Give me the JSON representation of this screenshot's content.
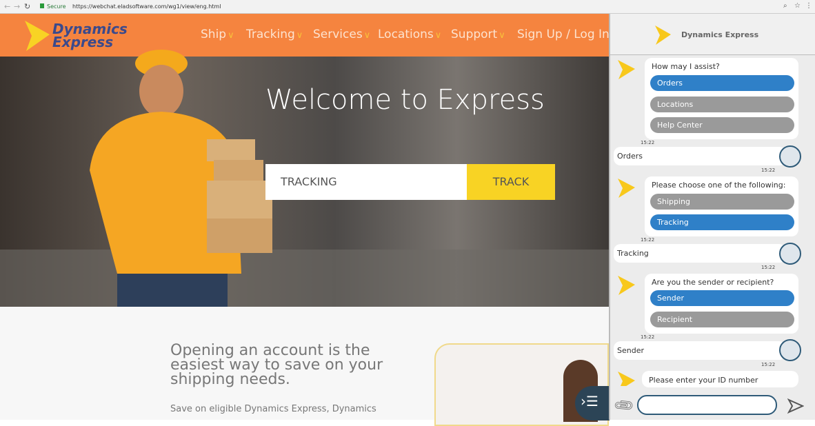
{
  "browser": {
    "secure_label": "Secure",
    "url": "https://webchat.eladsoftware.com/wg1/view/eng.html"
  },
  "site": {
    "logo": {
      "line1": "Dynamics",
      "line2": "Express"
    },
    "nav": [
      "Ship",
      "Tracking",
      "Services",
      "Locations",
      "Support"
    ],
    "signup": "Sign Up / Log In",
    "hero_title": "Welcome to Express",
    "tracking_placeholder": "TRACKING",
    "track_button": "TRACK",
    "promo_heading": "Opening an account is the easiest way to save on your shipping needs.",
    "promo_body": "Save on eligible Dynamics Express, Dynamics"
  },
  "chat": {
    "title": "Dynamics Express",
    "messages": [
      {
        "from": "bot",
        "text": "How may I assist?",
        "options": [
          {
            "label": "Orders",
            "selected": true
          },
          {
            "label": "Locations",
            "selected": false
          },
          {
            "label": "Help Center",
            "selected": false
          }
        ],
        "time": "15:22"
      },
      {
        "from": "user",
        "text": "Orders",
        "time": "15:22"
      },
      {
        "from": "bot",
        "text": "Please choose one of the following:",
        "options": [
          {
            "label": "Shipping",
            "selected": false
          },
          {
            "label": "Tracking",
            "selected": true
          }
        ],
        "time": "15:22"
      },
      {
        "from": "user",
        "text": "Tracking",
        "time": "15:22"
      },
      {
        "from": "bot",
        "text": "Are you the sender or recipient?",
        "options": [
          {
            "label": "Sender",
            "selected": true
          },
          {
            "label": "Recipient",
            "selected": false
          }
        ],
        "time": "15:22"
      },
      {
        "from": "user",
        "text": "Sender",
        "time": "15:22"
      },
      {
        "from": "bot",
        "text": "Please enter your ID number"
      }
    ],
    "input_value": ""
  },
  "colors": {
    "brand_orange": "#f5843f",
    "accent_yellow": "#f8d324",
    "selected_option": "#2f80c8",
    "option": "#9a9a9a"
  }
}
